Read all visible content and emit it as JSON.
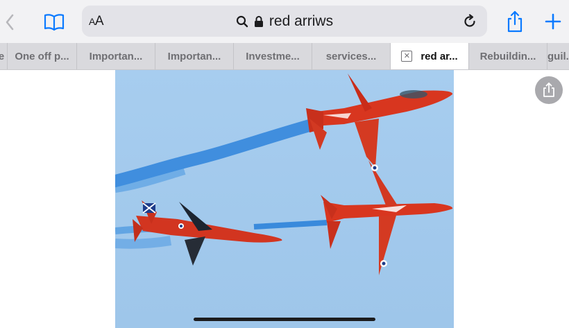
{
  "toolbar": {
    "back_icon": "chevron-left-icon",
    "bookmarks_icon": "book-icon",
    "text_size_label_small": "A",
    "text_size_label_large": "A",
    "address_text": "red arriws",
    "search_icon": "magnifier-icon",
    "lock_icon": "lock-icon",
    "reload_icon": "reload-icon",
    "share_icon": "share-icon",
    "new_tab_icon": "plus-icon",
    "accent_color": "#0a7aff"
  },
  "tabs": [
    {
      "label": "e"
    },
    {
      "label": "One off p..."
    },
    {
      "label": "Importan..."
    },
    {
      "label": "Importan..."
    },
    {
      "label": "Investme..."
    },
    {
      "label": "services..."
    },
    {
      "label": "red ar...",
      "active": true
    },
    {
      "label": "Rebuildin..."
    },
    {
      "label": "guil..."
    }
  ],
  "content": {
    "image_description_icon": "red-arrows-photo",
    "floating_share_icon": "share-icon"
  }
}
